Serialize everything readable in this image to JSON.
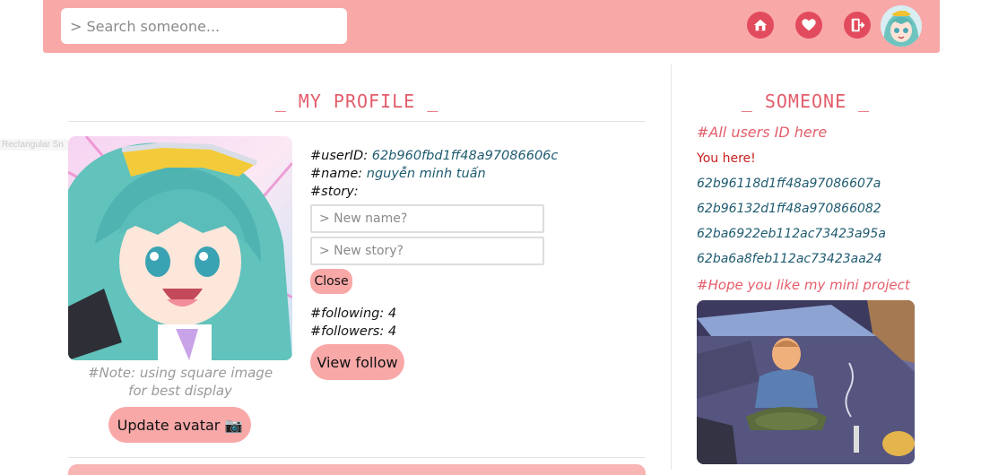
{
  "header": {
    "search_placeholder": "> Search someone...",
    "icons": [
      "home-icon",
      "heart-icon",
      "logout-icon"
    ]
  },
  "side_tag": "Rectangular Sn",
  "profile": {
    "title": "_ MY PROFILE _",
    "note_line1": "#Note: using square image",
    "note_line2": "for best display",
    "update_avatar": "Update avatar 📷",
    "userid_label": "#userID: ",
    "userid_value": "62b960fbd1ff48a97086606c",
    "name_label": "#name: ",
    "name_value": "nguyễn minh tuấn",
    "story_label": "#story:",
    "new_name_placeholder": "> New name?",
    "new_story_placeholder": "> New story?",
    "close": "Close",
    "following": "#following: 4",
    "followers": "#followers: 4",
    "view_follow": "View follow"
  },
  "someone": {
    "title": "_ SOMEONE _",
    "all_users": "#All users ID here",
    "you_here": "You here!",
    "ids": [
      "62b96118d1ff48a97086607a",
      "62b96132d1ff48a970866082",
      "62ba6922eb112ac73423a95a",
      "62ba6a8feb112ac73423aa24"
    ],
    "hope": "#Hope you like my mini project"
  },
  "colors": {
    "header_bg": "#f9a8a8",
    "accent_red": "#e35d6a",
    "icon_red": "#e24b5d",
    "id_blue": "#1f5b70",
    "you_here_red": "#c81e1e"
  }
}
